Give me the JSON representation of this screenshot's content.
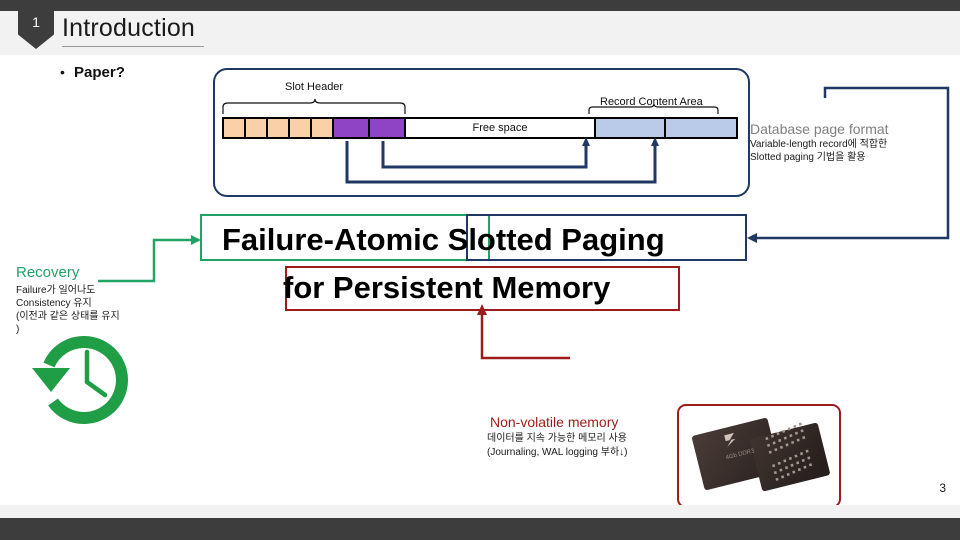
{
  "header": {
    "badge_number": "1",
    "title": "Introduction"
  },
  "footer": {
    "page_number": "3"
  },
  "bullet": {
    "marker": "•",
    "label": "Paper?"
  },
  "page_format_diagram": {
    "slot_header_label": "Slot Header",
    "record_content_area_label": "Record Content Area",
    "free_space_label": "Free space",
    "slot_cells": 5,
    "pointer_cells": 2,
    "record_cells": 2,
    "colors": {
      "slot_cell": "#fad0a8",
      "pointer_cell": "#8e44c4",
      "record_cell": "#b9cbe8",
      "outline": "#1f3864"
    }
  },
  "db_caption": {
    "heading": "Database page format",
    "line1": "Variable-length record에 적합한",
    "line2": "Slotted paging 기법을 활용",
    "heading_color": "#7f7f7f"
  },
  "title": {
    "part_green": "Failure-Atomic",
    "part_navy": "Slotted Paging",
    "part_red": "for Persistent Memory",
    "line1": "Failure-Atomic Slotted Paging",
    "line2": "for Persistent Memory",
    "green": "#21a366",
    "navy": "#1f3864",
    "red": "#9e1b1b"
  },
  "recovery": {
    "heading": "Recovery",
    "line1": "Failure가 일어나도",
    "line2": "Consistency 유지",
    "line3": "(이전과 같은 상태를 유지",
    "line4": ")",
    "heading_color": "#21a366",
    "icon": "recovery-clock-icon"
  },
  "nvm": {
    "heading": "Non-volatile memory",
    "line1": "데이터를 지속 가능한 메모리 사용",
    "line2": "(Journaling, WAL logging 부하↓)",
    "heading_color": "#9e1b1b",
    "image_alt": "nvdimm-memory-chip-photo"
  }
}
